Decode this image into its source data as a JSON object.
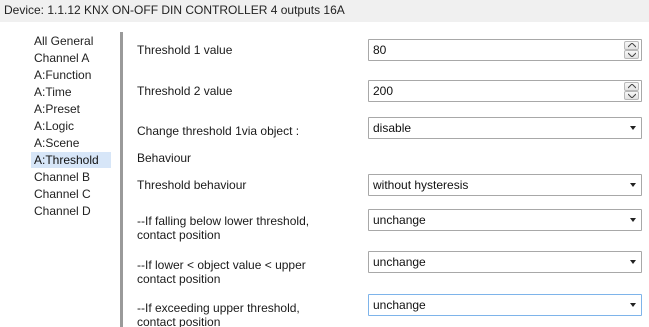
{
  "window": {
    "title": "Device: 1.1.12  KNX ON-OFF DIN CONTROLLER 4 outputs 16A"
  },
  "sidebar": {
    "items": [
      {
        "label": "All General",
        "selected": false
      },
      {
        "label": "Channel A",
        "selected": false
      },
      {
        "label": "A:Function",
        "selected": false
      },
      {
        "label": "A:Time",
        "selected": false
      },
      {
        "label": "A:Preset",
        "selected": false
      },
      {
        "label": "A:Logic",
        "selected": false
      },
      {
        "label": "A:Scene",
        "selected": false
      },
      {
        "label": "A:Threshold",
        "selected": true
      },
      {
        "label": "Channel B",
        "selected": false
      },
      {
        "label": "Channel C",
        "selected": false
      },
      {
        "label": "Channel D",
        "selected": false
      }
    ],
    "selected_color": "#d7e6f8"
  },
  "params": {
    "threshold1": {
      "label": "Threshold 1 value",
      "value": "80"
    },
    "threshold2": {
      "label": "Threshold 2 value",
      "value": "200"
    },
    "change_threshold": {
      "label": "Change threshold 1via object :",
      "value": "disable"
    },
    "behaviour_heading": "Behaviour",
    "threshold_behaviour": {
      "label": "Threshold behaviour",
      "value": "without hysteresis"
    },
    "falling_below": {
      "label_line1": "--If falling below lower threshold,",
      "label_line2": "contact position",
      "value": "unchange"
    },
    "between": {
      "label_line1": "--If lower < object value < upper",
      "label_line2": "contact position",
      "value": "unchange"
    },
    "exceeding": {
      "label_line1": "--If exceeding upper threshold,",
      "label_line2": "contact position",
      "value": "unchange"
    }
  }
}
